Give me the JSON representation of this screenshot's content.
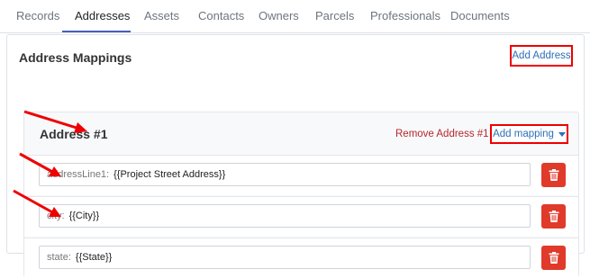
{
  "tabs": [
    "Records",
    "Addresses",
    "Assets",
    "Contacts",
    "Owners",
    "Parcels",
    "Professionals",
    "Documents"
  ],
  "active_tab": "Addresses",
  "panel": {
    "title": "Address Mappings",
    "add_address_label": "Add Address"
  },
  "address_card": {
    "title": "Address #1",
    "remove_label": "Remove Address #1",
    "add_mapping_label": "Add mapping",
    "mappings": [
      {
        "key": "addressLine1:",
        "value": "{{Project Street Address}}"
      },
      {
        "key": "city:",
        "value": "{{City}}"
      },
      {
        "key": "state:",
        "value": "{{State}}"
      }
    ]
  },
  "colors": {
    "highlight": "#ee0000",
    "delete": "#e03a2a",
    "link": "#2f6fb8",
    "remove": "#b3282d"
  },
  "icons": {
    "delete": "trash-icon",
    "dropdown": "caret-down-icon",
    "annotation": "red-arrow"
  }
}
